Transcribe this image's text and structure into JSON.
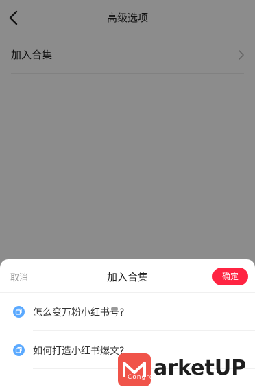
{
  "page": {
    "title": "高级选项",
    "row_label": "加入合集"
  },
  "sheet": {
    "cancel_label": "取消",
    "title": "加入合集",
    "confirm_label": "确定",
    "items": [
      {
        "label": "怎么变万粉小红书号?"
      },
      {
        "label": "如何打造小红书爆文?"
      }
    ]
  },
  "watermark": {
    "brand": "arketUP",
    "subtitle": "Congress & Expo Summit"
  },
  "colors": {
    "accent": "#ff2442",
    "item_icon": "#5aa9ff",
    "mask": "rgba(0,0,0,0.45)"
  }
}
